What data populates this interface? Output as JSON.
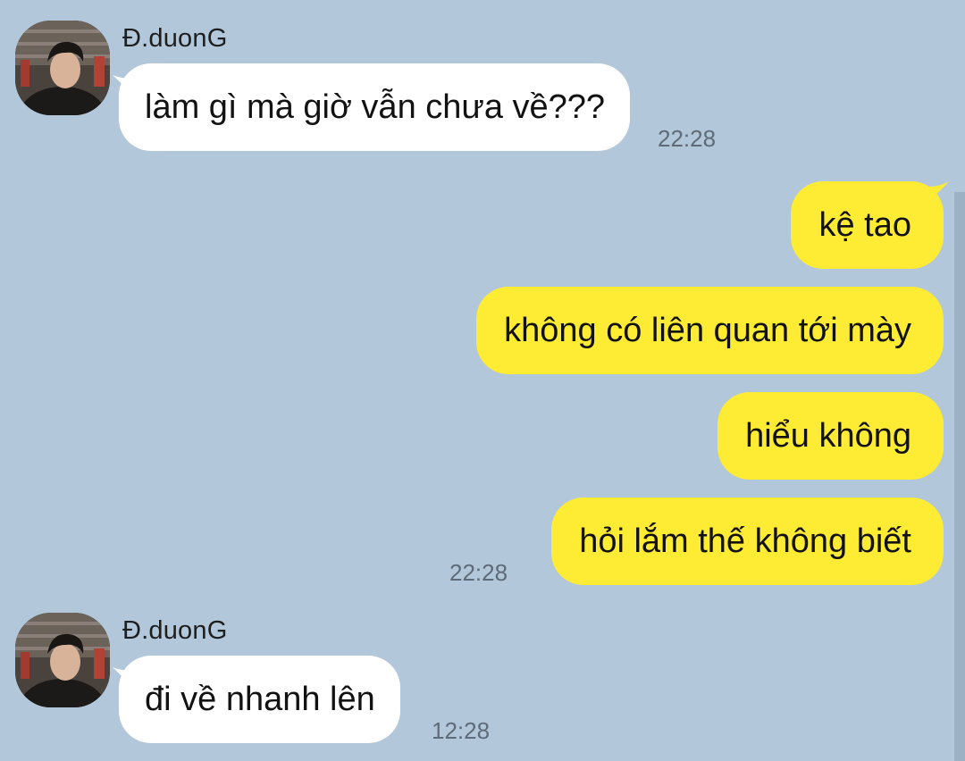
{
  "colors": {
    "background": "#B2C7DA",
    "incoming_bubble": "#FFFFFF",
    "outgoing_bubble": "#FEEB34",
    "timestamp": "#5f6b78"
  },
  "messages": [
    {
      "direction": "incoming",
      "sender": "Đ.duonG",
      "avatar_icon": "profile-photo",
      "bubbles": [
        "làm gì mà giờ vẫn chưa về???"
      ],
      "time": "22:28"
    },
    {
      "direction": "outgoing",
      "bubbles": [
        "kệ tao",
        "không có liên quan tới mày",
        "hiểu không",
        "hỏi lắm thế không biết"
      ],
      "time": "22:28"
    },
    {
      "direction": "incoming",
      "sender": "Đ.duonG",
      "avatar_icon": "profile-photo",
      "bubbles": [
        "đi về nhanh lên"
      ],
      "time": "12:28"
    }
  ]
}
